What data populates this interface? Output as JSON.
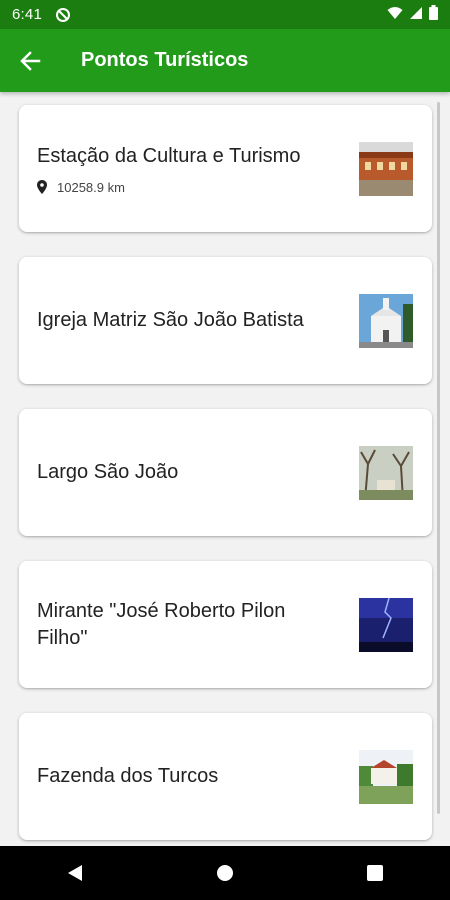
{
  "status_bar": {
    "time": "6:41"
  },
  "app_bar": {
    "title": "Pontos Turísticos",
    "back_icon": "arrow-left-icon"
  },
  "places": [
    {
      "name": "Estação da Cultura e Turismo",
      "distance": "10258.9 km"
    },
    {
      "name": "Igreja Matriz São João Batista"
    },
    {
      "name": "Largo São João"
    },
    {
      "name": "Mirante \"José Roberto Pilon Filho\""
    },
    {
      "name": "Fazenda dos Turcos"
    }
  ],
  "colors": {
    "status_bar": "#1b7d10",
    "app_bar": "#229a1a",
    "background": "#f2f2f2"
  }
}
